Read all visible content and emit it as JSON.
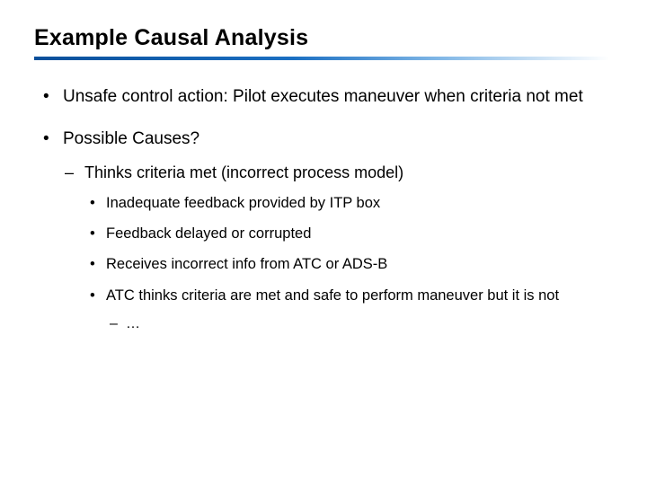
{
  "title": "Example Causal Analysis",
  "bullets": {
    "item1": "Unsafe control action: Pilot executes maneuver when criteria not met",
    "item2": "Possible Causes?",
    "sub1": "Thinks criteria met (incorrect process model)",
    "subsub1": "Inadequate feedback provided by ITP box",
    "subsub2": "Feedback delayed or corrupted",
    "subsub3": "Receives incorrect info from ATC or ADS-B",
    "subsub4": "ATC thinks criteria are met and safe to perform maneuver but it is not",
    "ellipsis": "…"
  }
}
